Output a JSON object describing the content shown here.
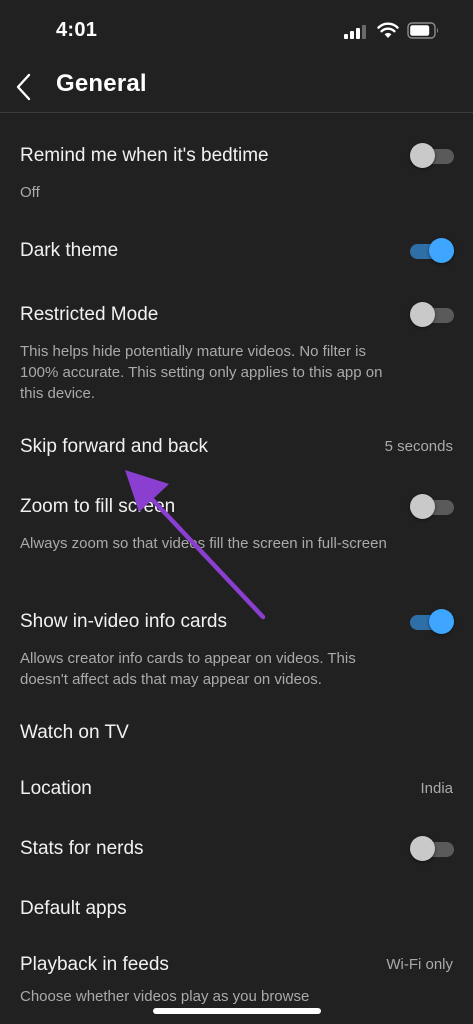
{
  "status_bar": {
    "time": "4:01"
  },
  "header": {
    "title": "General"
  },
  "colors": {
    "background": "#212121",
    "toggle_on": "#3ea6ff",
    "toggle_off": "#c9c9c9",
    "annotation_arrow": "#8a3fd1"
  },
  "settings": {
    "bedtime": {
      "title": "Remind me when it's bedtime",
      "desc": "Off",
      "toggle_on": false
    },
    "dark_theme": {
      "title": "Dark theme",
      "toggle_on": true
    },
    "restricted": {
      "title": "Restricted Mode",
      "desc": "This helps hide potentially mature videos. No filter is 100% accurate. This setting only applies to this app on this device.",
      "toggle_on": false
    },
    "skip": {
      "title": "Skip forward and back",
      "value": "5 seconds"
    },
    "zoom": {
      "title": "Zoom to fill screen",
      "desc": "Always zoom so that videos fill the screen in full-screen",
      "toggle_on": false
    },
    "info_cards": {
      "title": "Show in-video info cards",
      "desc": "Allows creator info cards to appear on videos. This doesn't affect ads that may appear on videos.",
      "toggle_on": true
    },
    "watch_tv": {
      "title": "Watch on TV"
    },
    "location": {
      "title": "Location",
      "value": "India"
    },
    "stats": {
      "title": "Stats for nerds",
      "toggle_on": false
    },
    "default_apps": {
      "title": "Default apps"
    },
    "playback": {
      "title": "Playback in feeds",
      "value": "Wi-Fi only",
      "desc": "Choose whether videos play as you browse"
    }
  }
}
